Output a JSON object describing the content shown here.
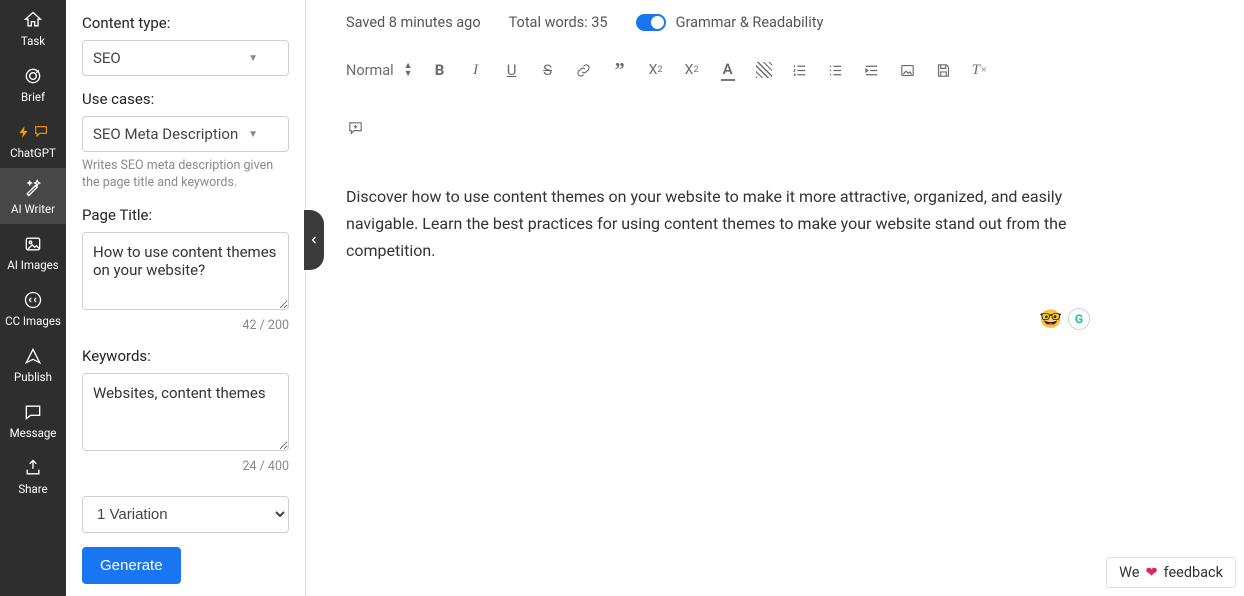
{
  "rail": {
    "task": "Task",
    "brief": "Brief",
    "chatgpt": "ChatGPT",
    "ai_writer": "AI Writer",
    "ai_images": "AI Images",
    "cc_images": "CC Images",
    "publish": "Publish",
    "message": "Message",
    "share": "Share"
  },
  "panel": {
    "content_type_label": "Content type:",
    "content_type_value": "SEO",
    "use_cases_label": "Use cases:",
    "use_cases_value": "SEO Meta Description",
    "use_cases_hint": "Writes SEO meta description given the page title and keywords.",
    "page_title_label": "Page Title:",
    "page_title_value": "How to use content themes on your website?",
    "page_title_counter": "42 / 200",
    "keywords_label": "Keywords:",
    "keywords_value": "Websites, content themes",
    "keywords_counter": "24 / 400",
    "variations_value": "1 Variation",
    "generate_label": "Generate"
  },
  "editor": {
    "saved": "Saved 8 minutes ago",
    "total_words": "Total words: 35",
    "toggle_label": "Grammar & Readability",
    "heading_select": "Normal",
    "body": "Discover how to use content themes on your website to make it more attractive, organized, and easily navigable. Learn the best practices for using content themes to make your website stand out from the competition."
  },
  "feedback": {
    "prefix": "We",
    "suffix": "feedback"
  }
}
